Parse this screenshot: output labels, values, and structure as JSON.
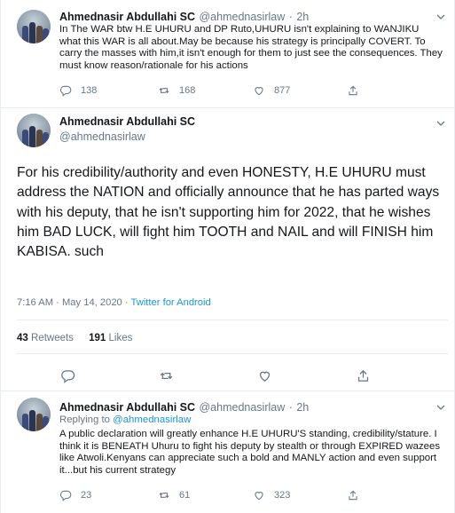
{
  "tweet1": {
    "name": "Ahmednasir Abdullahi SC",
    "handle": "@ahmednasirlaw",
    "separator": "·",
    "time": "2h",
    "text": "In The WAR btw H.E UHURU and DP Ruto,UHURU isn't explaining to WANJIKU what this WAR is all about.May be because his strategy is principally COVERT. To carry the masses with him,it isn't enough for them to just see the consequences. They must know reason/rationale for his actions",
    "replies": "138",
    "retweets": "168",
    "likes": "877"
  },
  "tweet2": {
    "name": "Ahmednasir Abdullahi SC",
    "handle": "@ahmednasirlaw",
    "text": "For his credibility/authority and even HONESTY, H.E UHURU must address the NATION and officially announce that he has parted ways with his deputy, that he isn't supporting him for 2022, that he wishes him BAD LUCK, will fight him TOOTH and NAIL and will FINISH him KABISA. such",
    "timestamp": "7:16 AM · May 14, 2020 · ",
    "source": "Twitter for Android",
    "retweets_count": "43",
    "retweets_label": "Retweets",
    "likes_count": "191",
    "likes_label": "Likes"
  },
  "tweet3": {
    "name": "Ahmednasir Abdullahi SC",
    "handle": "@ahmednasirlaw",
    "separator": "·",
    "time": "2h",
    "replying_label": "Replying to ",
    "replying_to": "@ahmednasirlaw",
    "text": "A public declaration will greatly enhance H.E UHURU'S standing, credibility/stature. I think it is BENEATH Uhuru to fight his deputy by stealth or through EXPIRED wazees like Atwoli.Kenyans can appreciate such a bold and MANLY action and even support it...but his current strategy",
    "replies": "23",
    "retweets": "61",
    "likes": "323"
  },
  "colors": {
    "accent": "#1b95e0",
    "muted": "#657786",
    "border": "#e6ecf0"
  },
  "icons": [
    "reply-icon",
    "retweet-icon",
    "like-icon",
    "share-icon",
    "chevron-down-icon"
  ]
}
